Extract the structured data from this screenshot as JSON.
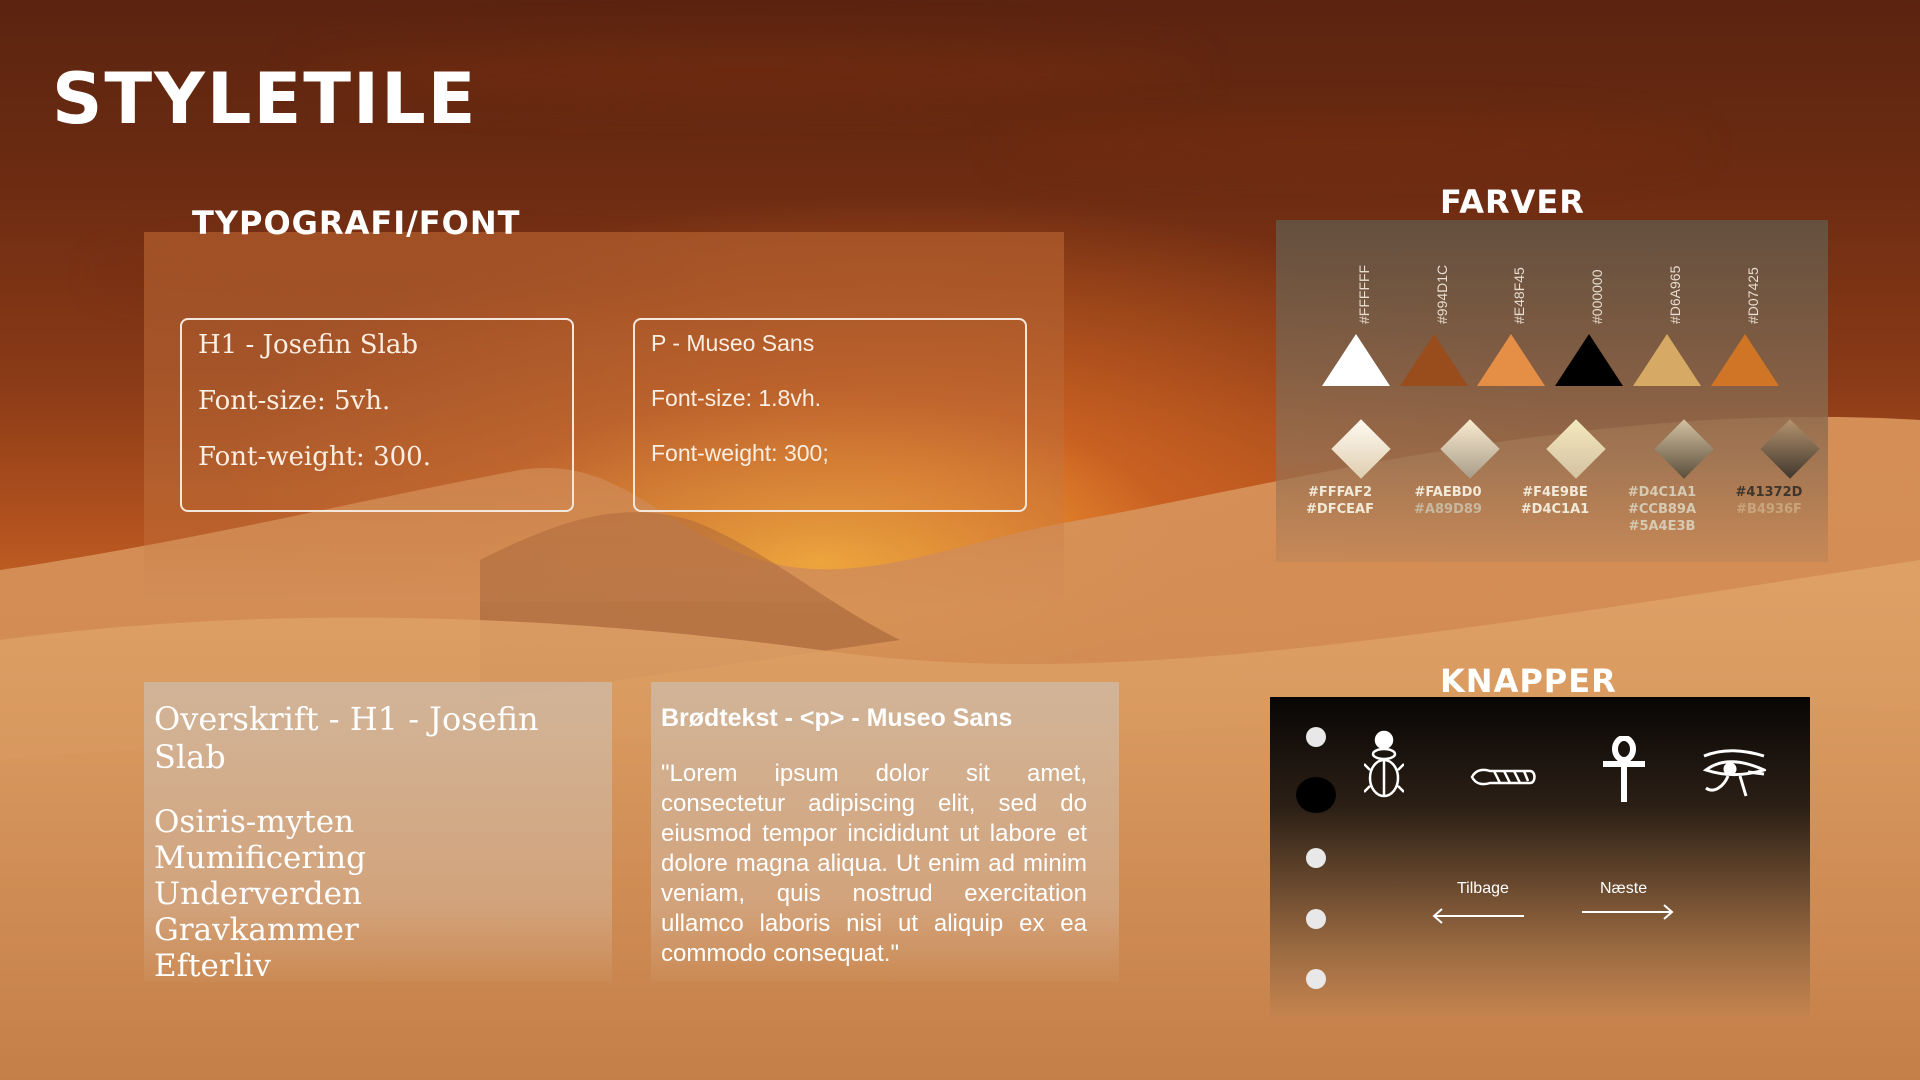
{
  "title": "STYLETILE",
  "typography": {
    "heading": "TYPOGRAFI/FONT",
    "h1_box": {
      "line1": "H1 - Josefin Slab",
      "line2": "Font-size: 5vh.",
      "line3": "Font-weight: 300."
    },
    "p_box": {
      "line1": "P - Museo Sans",
      "line2": "Font-size: 1.8vh.",
      "line3": "Font-weight: 300;"
    }
  },
  "sample_h1": {
    "title": "Overskrift - H1 - Josefin Slab",
    "items": [
      "Osiris-myten",
      "Mumificering",
      "Underverden",
      "Gravkammer",
      "Efterliv"
    ]
  },
  "sample_p": {
    "title": "Brødtekst - <p> - Museo Sans",
    "text": "\"Lorem ipsum dolor sit amet, consectetur adipiscing elit, sed do eiusmod tempor incididunt ut labore et dolore magna aliqua. Ut enim ad minim veniam, quis nostrud exercitation ullamco laboris nisi ut aliquip ex ea commodo consequat.\""
  },
  "colors": {
    "heading": "FARVER",
    "swatches": [
      {
        "hex": "#FFFFFF",
        "color": "#FFFFFF"
      },
      {
        "hex": "#994D1C",
        "color": "#994D1C"
      },
      {
        "hex": "#E48F45",
        "color": "#E48F45"
      },
      {
        "hex": "#000000",
        "color": "#000000"
      },
      {
        "hex": "#D6A965",
        "color": "#D6A965"
      },
      {
        "hex": "#D07425",
        "color": "#D07425"
      }
    ],
    "gradients": [
      {
        "line1": "#FFFAF2",
        "line2": "#DFCEAF",
        "line3": "",
        "from": "#FFFAF2",
        "to": "#DFCEAF"
      },
      {
        "line1": "#FAEBD0",
        "line2": "#A89D89",
        "line3": "",
        "from": "#FAEBD0",
        "to": "#A89D89"
      },
      {
        "line1": "#F4E9BE",
        "line2": "#D4C1A1",
        "line3": "",
        "from": "#F4E9BE",
        "to": "#D4C1A1"
      },
      {
        "line1": "#D4C1A1",
        "line2": "#CCB89A",
        "line3": "#5A4E3B",
        "from": "#D4C1A1",
        "to": "#5A4E3B"
      },
      {
        "line1": "#41372D",
        "line2": "#B4936F",
        "line3": "",
        "from": "#B4936F",
        "to": "#41372D"
      }
    ]
  },
  "buttons": {
    "heading": "KNAPPER",
    "icons": [
      "scarab-icon",
      "mummy-icon",
      "ankh-icon",
      "eye-of-horus-icon"
    ],
    "back_label": "Tilbage",
    "next_label": "Næste"
  }
}
